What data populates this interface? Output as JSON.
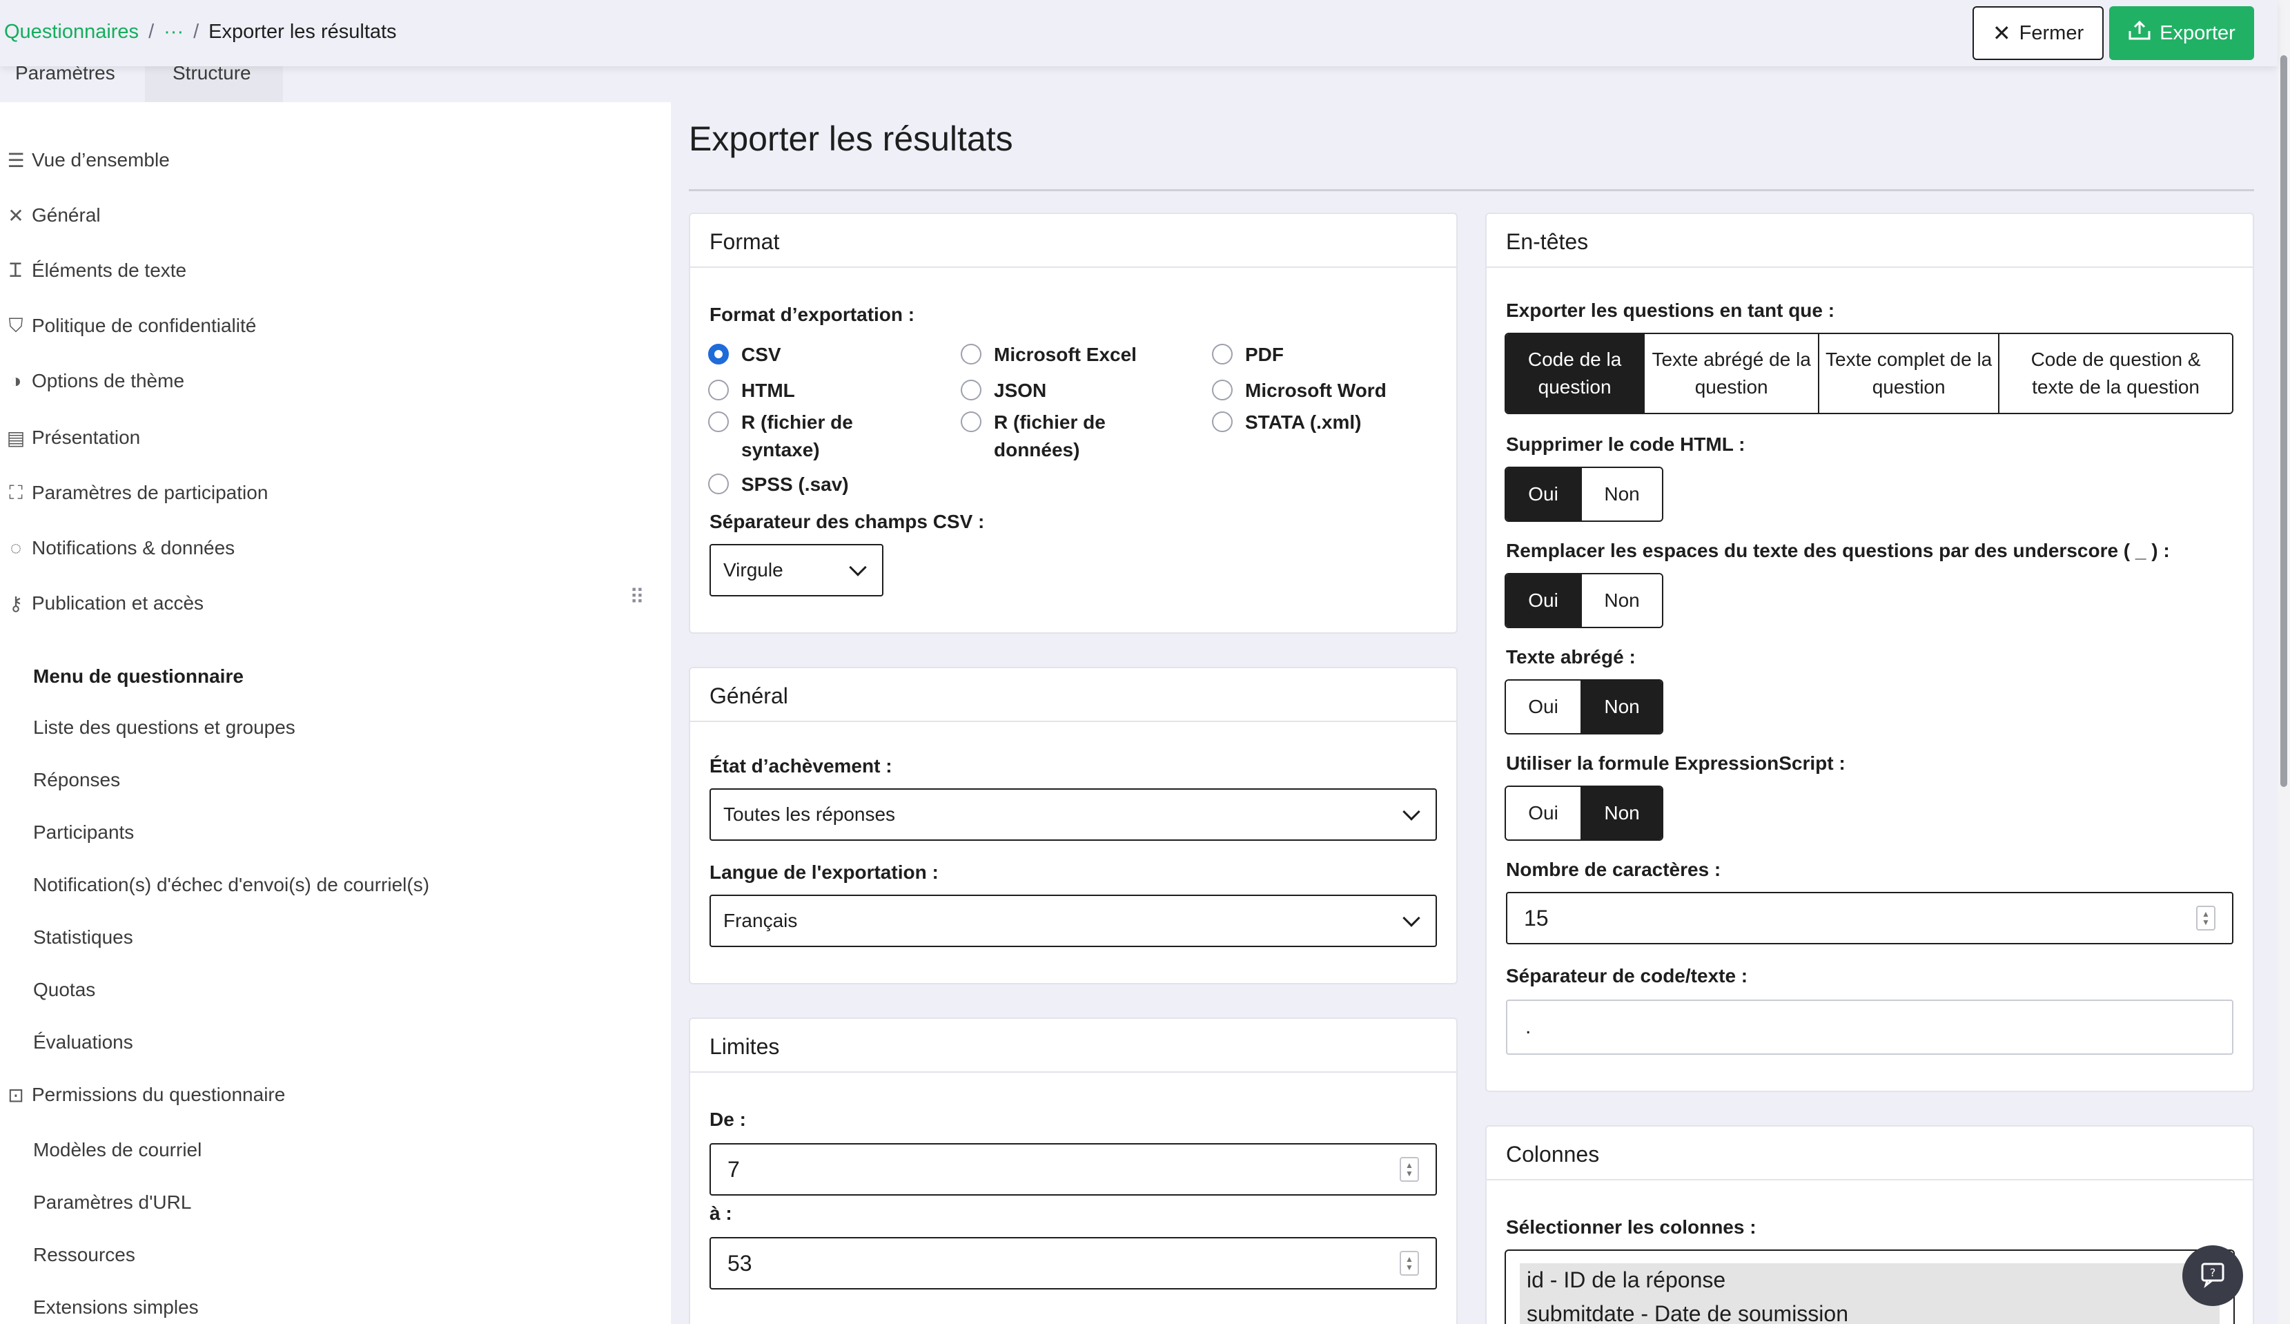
{
  "breadcrumb": {
    "root": "Questionnaires",
    "ellipsis": "···",
    "current": "Exporter les résultats"
  },
  "actions": {
    "close": "Fermer",
    "export": "Exporter"
  },
  "tabs": {
    "settings": "Paramètres",
    "structure": "Structure"
  },
  "sidebar": {
    "items": [
      "Vue d’ensemble",
      "Général",
      "Éléments de texte",
      "Politique de confidentialité",
      "Options de thème",
      "Présentation",
      "Paramètres de participation",
      "Notifications & données",
      "Publication et accès"
    ],
    "menu_heading": "Menu de questionnaire",
    "menu": [
      "Liste des questions et groupes",
      "Réponses",
      "Participants",
      "Notification(s) d'échec d'envoi(s) de courriel(s)",
      "Statistiques",
      "Quotas",
      "Évaluations"
    ],
    "permissions": "Permissions du questionnaire",
    "menu2": [
      "Modèles de courriel",
      "Paramètres d'URL",
      "Ressources",
      "Extensions simples"
    ]
  },
  "page_title": "Exporter les résultats",
  "format": {
    "title": "Format",
    "label": "Format d’exportation :",
    "options": [
      "CSV",
      "Microsoft Excel",
      "PDF",
      "HTML",
      "JSON",
      "Microsoft Word",
      "R (fichier de syntaxe)",
      "R (fichier de données)",
      "STATA (.xml)",
      "SPSS (.sav)"
    ],
    "selected": "CSV",
    "separator_label": "Séparateur des champs CSV :",
    "separator_value": "Virgule"
  },
  "general": {
    "title": "Général",
    "completion_label": "État d’achèvement :",
    "completion_value": "Toutes les réponses",
    "lang_label": "Langue de l'exportation :",
    "lang_value": "Français"
  },
  "limits": {
    "title": "Limites",
    "from_label": "De :",
    "from_value": "7",
    "to_label": "à :",
    "to_value": "53"
  },
  "headers": {
    "title": "En-têtes",
    "export_as_label": "Exporter les questions en tant que :",
    "export_as": [
      "Code de la question",
      "Texte abrégé de la question",
      "Texte complet de la question",
      "Code de question & texte de la question"
    ],
    "strip_html_label": "Supprimer le code HTML :",
    "replace_spaces_label": "Remplacer les espaces du texte des questions par des underscore ( _ ) :",
    "abbreviated_label": "Texte abrégé :",
    "expression_label": "Utiliser la formule ExpressionScript :",
    "yes": "Oui",
    "no": "Non",
    "chars_label": "Nombre de caractères :",
    "chars_value": "15",
    "code_sep_label": "Séparateur de code/texte :",
    "code_sep_value": "."
  },
  "columns": {
    "title": "Colonnes",
    "select_label": "Sélectionner les colonnes :",
    "items": [
      "id - ID de la réponse",
      "submitdate - Date de soumission"
    ]
  },
  "colors": {
    "accent_green": "#21b165",
    "link_green": "#14ae5c",
    "radio_blue": "#1e6bd9",
    "dark": "#1e1e1e"
  }
}
